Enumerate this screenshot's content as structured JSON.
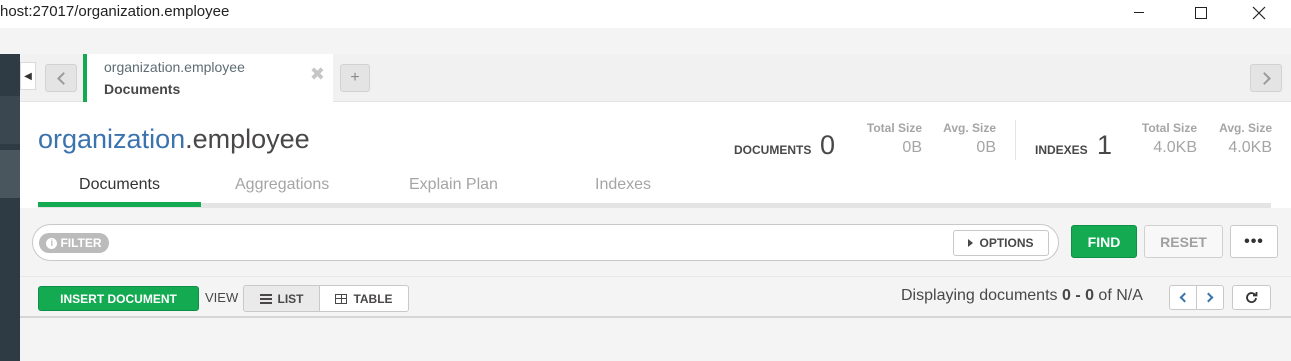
{
  "window": {
    "title": "host:27017/organization.employee"
  },
  "tab": {
    "namespace": "organization.employee",
    "label": "Documents",
    "close": "✖",
    "new_tab": "+"
  },
  "header": {
    "db": "organization",
    "collection": ".employee"
  },
  "stats": {
    "documents_label": "Documents",
    "documents_count": "0",
    "doc_total_size_label": "Total Size",
    "doc_total_size": "0B",
    "doc_avg_size_label": "Avg. Size",
    "doc_avg_size": "0B",
    "indexes_label": "Indexes",
    "indexes_count": "1",
    "idx_total_size_label": "Total Size",
    "idx_total_size": "4.0KB",
    "idx_avg_size_label": "Avg. Size",
    "idx_avg_size": "4.0KB"
  },
  "subtabs": [
    "Documents",
    "Aggregations",
    "Explain Plan",
    "Indexes"
  ],
  "query": {
    "filter_label": "FILTER",
    "options_label": "OPTIONS",
    "find_label": "FIND",
    "reset_label": "RESET",
    "more_label": "•••"
  },
  "actions": {
    "insert_label": "INSERT DOCUMENT",
    "view_label": "VIEW",
    "list_label": "LIST",
    "table_label": "TABLE",
    "paging_prefix": "Displaying documents ",
    "paging_range": "0 - 0",
    "paging_suffix": " of N/A"
  },
  "colors": {
    "accent_green": "#13aa52",
    "db_blue": "#3b73ae"
  }
}
